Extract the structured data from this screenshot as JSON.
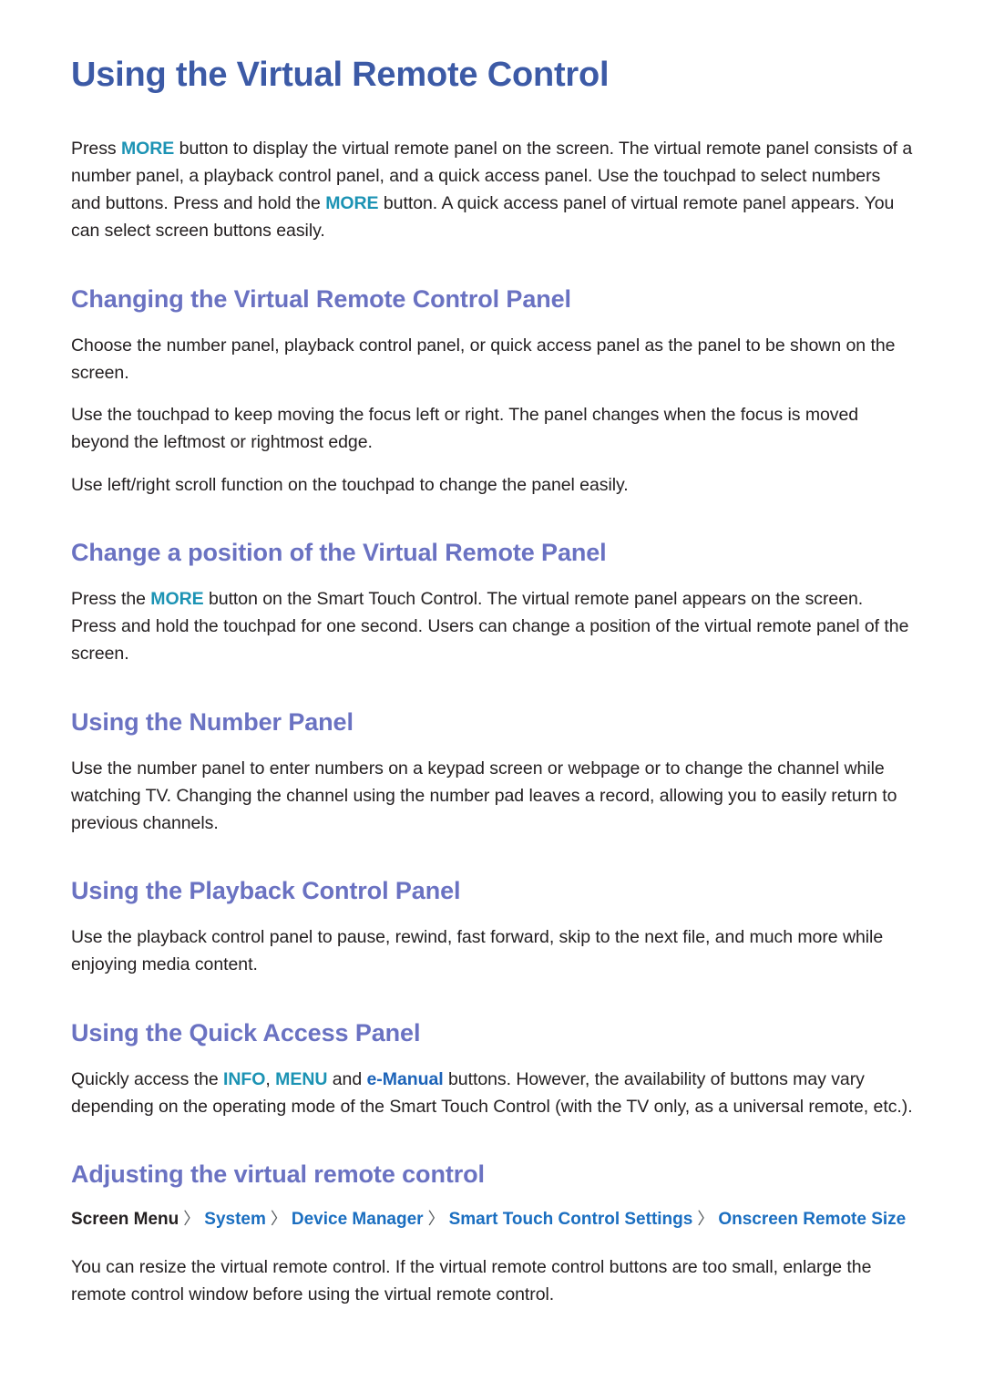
{
  "document": {
    "title": "Using the Virtual Remote Control",
    "intro": {
      "part1": "Press ",
      "kw1": "MORE",
      "part2": " button to display the virtual remote panel on the screen. The virtual remote panel consists of a number panel, a playback control panel, and a quick access panel. Use the touchpad to select numbers and buttons. Press and hold the ",
      "kw2": "MORE",
      "part3": " button. A quick access panel of virtual remote panel appears. You can select screen buttons easily."
    },
    "sections": [
      {
        "heading": "Changing the Virtual Remote Control Panel",
        "paragraphs": [
          "Choose the number panel, playback control panel, or quick access panel as the panel to be shown on the screen.",
          "Use the touchpad to keep moving the focus left or right. The panel changes when the focus is moved beyond the leftmost or rightmost edge.",
          "Use left/right scroll function on the touchpad to change the panel easily."
        ]
      },
      {
        "heading": "Change a position of the Virtual Remote Panel",
        "rich": {
          "part1": "Press the ",
          "kw1": "MORE",
          "part2": " button on the Smart Touch Control. The virtual remote panel appears on the screen. Press and hold the touchpad for one second. Users can change a position of the virtual remote panel of the screen."
        }
      },
      {
        "heading": "Using the Number Panel",
        "paragraphs": [
          "Use the number panel to enter numbers on a keypad screen or webpage or to change the channel while watching TV. Changing the channel using the number pad leaves a record, allowing you to easily return to previous channels."
        ]
      },
      {
        "heading": "Using the Playback Control Panel",
        "paragraphs": [
          "Use the playback control panel to pause, rewind, fast forward, skip to the next file, and much more while enjoying media content."
        ]
      },
      {
        "heading": "Using the Quick Access Panel",
        "rich": {
          "part1": "Quickly access the ",
          "kw1": "INFO",
          "sep1": ", ",
          "kw2": "MENU",
          "sep2": " and ",
          "kw3": "e-Manual",
          "part2": " buttons. However, the availability of buttons may vary depending on the operating mode of the Smart Touch Control (with the TV only, as a universal remote, etc.)."
        }
      },
      {
        "heading": "Adjusting the virtual remote control",
        "breadcrumb": {
          "root": "Screen Menu",
          "separator": "〉",
          "items": [
            "System",
            "Device Manager",
            "Smart Touch Control Settings",
            "Onscreen Remote Size"
          ]
        },
        "paragraphs": [
          "You can resize the virtual remote control. If the virtual remote control buttons are too small, enlarge the remote control window before using the virtual remote control."
        ]
      }
    ]
  },
  "colors": {
    "title_blue": "#3c5aa6",
    "section_purple": "#6a72c2",
    "keyword_teal": "#1c93b4",
    "keyword_blue": "#1c63b8",
    "breadcrumb_link": "#1a6ec0",
    "body_text": "#231f20"
  }
}
